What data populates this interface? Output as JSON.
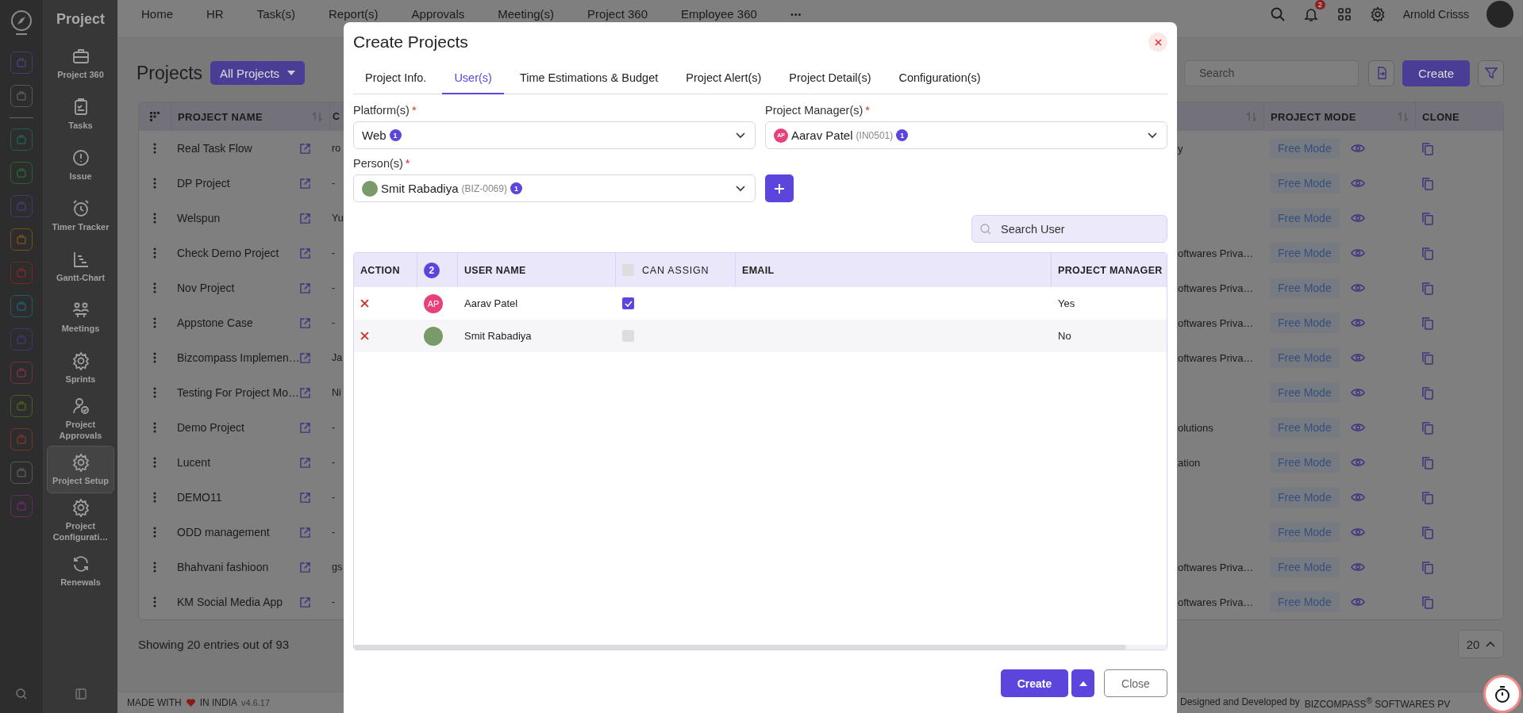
{
  "rail": {
    "apps": [
      {
        "color": "#453e78"
      },
      {
        "color": "#585858"
      },
      {
        "color": "#205d53"
      },
      {
        "color": "#266435"
      },
      {
        "color": "#483678"
      },
      {
        "color": "#785018"
      },
      {
        "color": "#782828"
      },
      {
        "color": "#205b68"
      },
      {
        "color": "#3d3678"
      },
      {
        "color": "#783040"
      },
      {
        "color": "#486020"
      },
      {
        "color": "#783528"
      },
      {
        "color": "#585858"
      },
      {
        "color": "#682868"
      }
    ]
  },
  "sidebar": {
    "title": "Project",
    "items": [
      {
        "label": "Project 360",
        "kind": "briefcase",
        "selected": false
      },
      {
        "label": "Tasks",
        "kind": "clipboard",
        "selected": false
      },
      {
        "label": "Issue",
        "kind": "alert",
        "selected": false
      },
      {
        "label": "Timer Tracker",
        "kind": "alarm",
        "selected": false
      },
      {
        "label": "Gantt-Chart",
        "kind": "gantt",
        "selected": false
      },
      {
        "label": "Meetings",
        "kind": "meeting",
        "selected": false
      },
      {
        "label": "Sprints",
        "kind": "gear",
        "selected": false
      },
      {
        "label": "Project Approvals",
        "kind": "person",
        "selected": false
      },
      {
        "label": "Project Setup",
        "kind": "gear",
        "selected": true
      },
      {
        "label": "Project Configurati…",
        "kind": "gear",
        "selected": false
      },
      {
        "label": "Renewals",
        "kind": "refresh",
        "selected": false
      }
    ]
  },
  "nav": {
    "items": [
      "Home",
      "HR",
      "Task(s)",
      "Report(s)",
      "Approvals",
      "Meeting(s)",
      "Project 360",
      "Employee 360"
    ],
    "more": "•••",
    "notifications": "2",
    "user": "Arnold Crisss"
  },
  "page": {
    "title": "Projects",
    "filter": "All Projects",
    "search": {
      "placeholder": "Search"
    },
    "create": "Create",
    "table": {
      "columns": [
        "PROJECT NAME",
        "C",
        "PROJECT MODE",
        "CLONE"
      ],
      "rows": [
        {
          "name": "Real Task Flow",
          "column_3": "ro",
          "column_4": "y",
          "mode": "Free Mode"
        },
        {
          "name": "DP Project",
          "column_3": "-",
          "mode": "Free Mode"
        },
        {
          "name": "Welspun",
          "column_3": "Yu",
          "mode": "Free Mode"
        },
        {
          "name": "Check Demo Project",
          "column_3": "-",
          "column_4": "oftwares Priva…",
          "mode": "Free Mode"
        },
        {
          "name": "Nov Project",
          "column_3": "-",
          "column_4": "oftwares Priva…",
          "mode": "Free Mode"
        },
        {
          "name": "Appstone Case",
          "column_3": "-",
          "column_4": "oftwares Priva…",
          "mode": "Free Mode"
        },
        {
          "name": "Bizcompass Implemen…",
          "column_3": "Ja",
          "column_4": "oftwares Priva…",
          "mode": "Free Mode"
        },
        {
          "name": "Testing For Project Mo…",
          "column_3": "Ni",
          "mode": "Free Mode"
        },
        {
          "name": "Demo Project",
          "column_3": "-",
          "column_4": "olutions",
          "mode": "Free Mode"
        },
        {
          "name": "Lucent",
          "column_3": "-",
          "column_4": "ation",
          "mode": "Free Mode"
        },
        {
          "name": "DEMO11",
          "column_3": "-",
          "mode": "Free Mode"
        },
        {
          "name": "ODD management",
          "column_3": "-",
          "mode": "Free Mode"
        },
        {
          "name": "Bhahvani fashioon",
          "column_3": "gs",
          "column_4": "oftwares Priva…",
          "mode": "Free Mode"
        },
        {
          "name": "KM Social Media App",
          "column_3": "-",
          "column_4": "oftwares Priva…",
          "mode": "Free Mode"
        }
      ]
    },
    "showing": "Showing 20 entries out of 93",
    "page_size": "20"
  },
  "footer": {
    "made_with": "MADE WITH",
    "in_india": "IN INDIA",
    "version": "v4.6.17",
    "designed_by": "Designed and Developed by",
    "company": "BIZCOMPASS$^{®}$ SOFTWARES PV"
  },
  "modal": {
    "title": "Create Projects",
    "tabs": [
      {
        "label": "Project Info.",
        "selected": false
      },
      {
        "label": "User(s)",
        "selected": true
      },
      {
        "label": "Time Estimations & Budget",
        "selected": false
      },
      {
        "label": "Project Alert(s)",
        "selected": false
      },
      {
        "label": "Project Detail(s)",
        "selected": false
      },
      {
        "label": "Configuration(s)",
        "selected": false
      }
    ],
    "platform": {
      "label": "Platform(s)",
      "required_mark": "*",
      "value": "Web",
      "count": "1"
    },
    "project_manager": {
      "label": "Project Manager(s)",
      "required_mark": "*",
      "initials": "AP",
      "value": "Aarav Patel",
      "code": "(IN0501)",
      "count": "1"
    },
    "persons": {
      "label": "Person(s)",
      "required_mark": "*",
      "value": "Smit Rabadiya",
      "code": "(BIZ-0069)",
      "count": "1"
    },
    "search": {
      "placeholder": "Search User"
    },
    "table": {
      "columns": [
        "ACTION",
        "2",
        "USER NAME",
        "CAN ASSIGN",
        "EMAIL",
        "PROJECT MANAGER"
      ],
      "can_assign_all": false,
      "rows": [
        {
          "kind": "initials",
          "initials": "AP",
          "name": "Aarav Patel",
          "can_assign": true,
          "project_manager": "Yes"
        },
        {
          "kind": "photo",
          "name": "Smit Rabadiya",
          "can_assign": false,
          "project_manager": "No"
        }
      ]
    },
    "buttons": {
      "create": "Create",
      "close": "Close"
    }
  }
}
